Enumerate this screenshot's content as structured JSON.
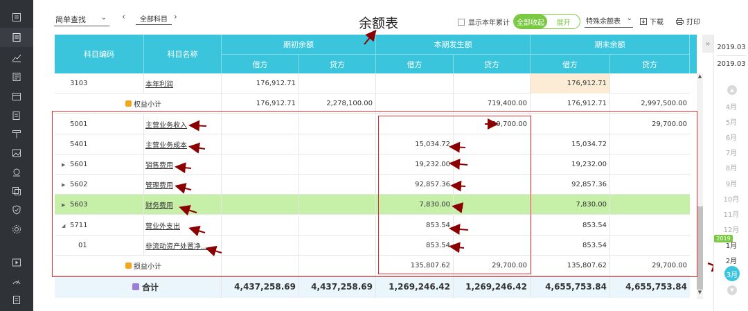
{
  "toolbar": {
    "search_mode": "简单查找",
    "subject_filter": "全部科目",
    "title": "余额表",
    "show_cumulative": "显示本年累计",
    "toggle_collapse": "全部收起",
    "toggle_expand": "展开",
    "special_select": "特殊余额表",
    "download": "下载",
    "print": "打印"
  },
  "table": {
    "headers": {
      "code": "科目编码",
      "name": "科目名称",
      "opening": "期初余额",
      "period": "本期发生额",
      "closing": "期末余额",
      "debit": "借方",
      "credit": "贷方"
    },
    "rows": [
      {
        "code": "3103",
        "name": "本年利润",
        "od": "176,912.71",
        "oc": "",
        "pd": "",
        "pc": "",
        "cd": "176,912.71",
        "cc": ""
      },
      {
        "subtotal": "权益小计",
        "od": "176,912.71",
        "oc": "2,278,100.00",
        "pd": "",
        "pc": "719,400.00",
        "cd": "176,912.71",
        "cc": "2,997,500.00"
      },
      {
        "code": "5001",
        "name": "主营业务收入",
        "od": "",
        "oc": "",
        "pd": "",
        "pc": "29,700.00",
        "cd": "",
        "cc": "29,700.00"
      },
      {
        "code": "5401",
        "name": "主营业务成本",
        "od": "",
        "oc": "",
        "pd": "15,034.72",
        "pc": "",
        "cd": "15,034.72",
        "cc": ""
      },
      {
        "code": "5601",
        "name": "销售费用",
        "od": "",
        "oc": "",
        "pd": "19,232.00",
        "pc": "",
        "cd": "19,232.00",
        "cc": ""
      },
      {
        "code": "5602",
        "name": "管理费用",
        "od": "",
        "oc": "",
        "pd": "92,857.36",
        "pc": "",
        "cd": "92,857.36",
        "cc": ""
      },
      {
        "code": "5603",
        "name": "财务费用",
        "od": "",
        "oc": "",
        "pd": "7,830.00",
        "pc": "",
        "cd": "7,830.00",
        "cc": ""
      },
      {
        "code": "5711",
        "name": "营业外支出",
        "od": "",
        "oc": "",
        "pd": "853.54",
        "pc": "",
        "cd": "853.54",
        "cc": ""
      },
      {
        "code": "01",
        "name": "非流动资产处置净...",
        "od": "",
        "oc": "",
        "pd": "853.54",
        "pc": "",
        "cd": "853.54",
        "cc": ""
      },
      {
        "subtotal": "损益小计",
        "od": "",
        "oc": "",
        "pd": "135,807.62",
        "pc": "29,700.00",
        "cd": "135,807.62",
        "cc": "29,700.00"
      }
    ],
    "total": {
      "label": "合计",
      "od": "4,437,258.69",
      "oc": "4,437,258.69",
      "pd": "1,269,246.42",
      "pc": "1,269,246.42",
      "cd": "4,655,753.84",
      "cc": "4,655,753.84"
    }
  },
  "period_panel": {
    "start": "2019.03",
    "end": "2019.03",
    "months_2018": [
      "4月",
      "5月",
      "6月",
      "7月",
      "8月",
      "9月",
      "10月",
      "11月",
      "12月"
    ],
    "year_badge": "2019",
    "months_2019": [
      "1月",
      "2月"
    ],
    "selected_month": "3月"
  },
  "colors": {
    "header_bg": "#3ac5dc",
    "highlight_row": "#c6efa7",
    "toggle_green": "#7ac943",
    "annotation_red": "#e03030",
    "arrow_dark_red": "#8b0000"
  }
}
